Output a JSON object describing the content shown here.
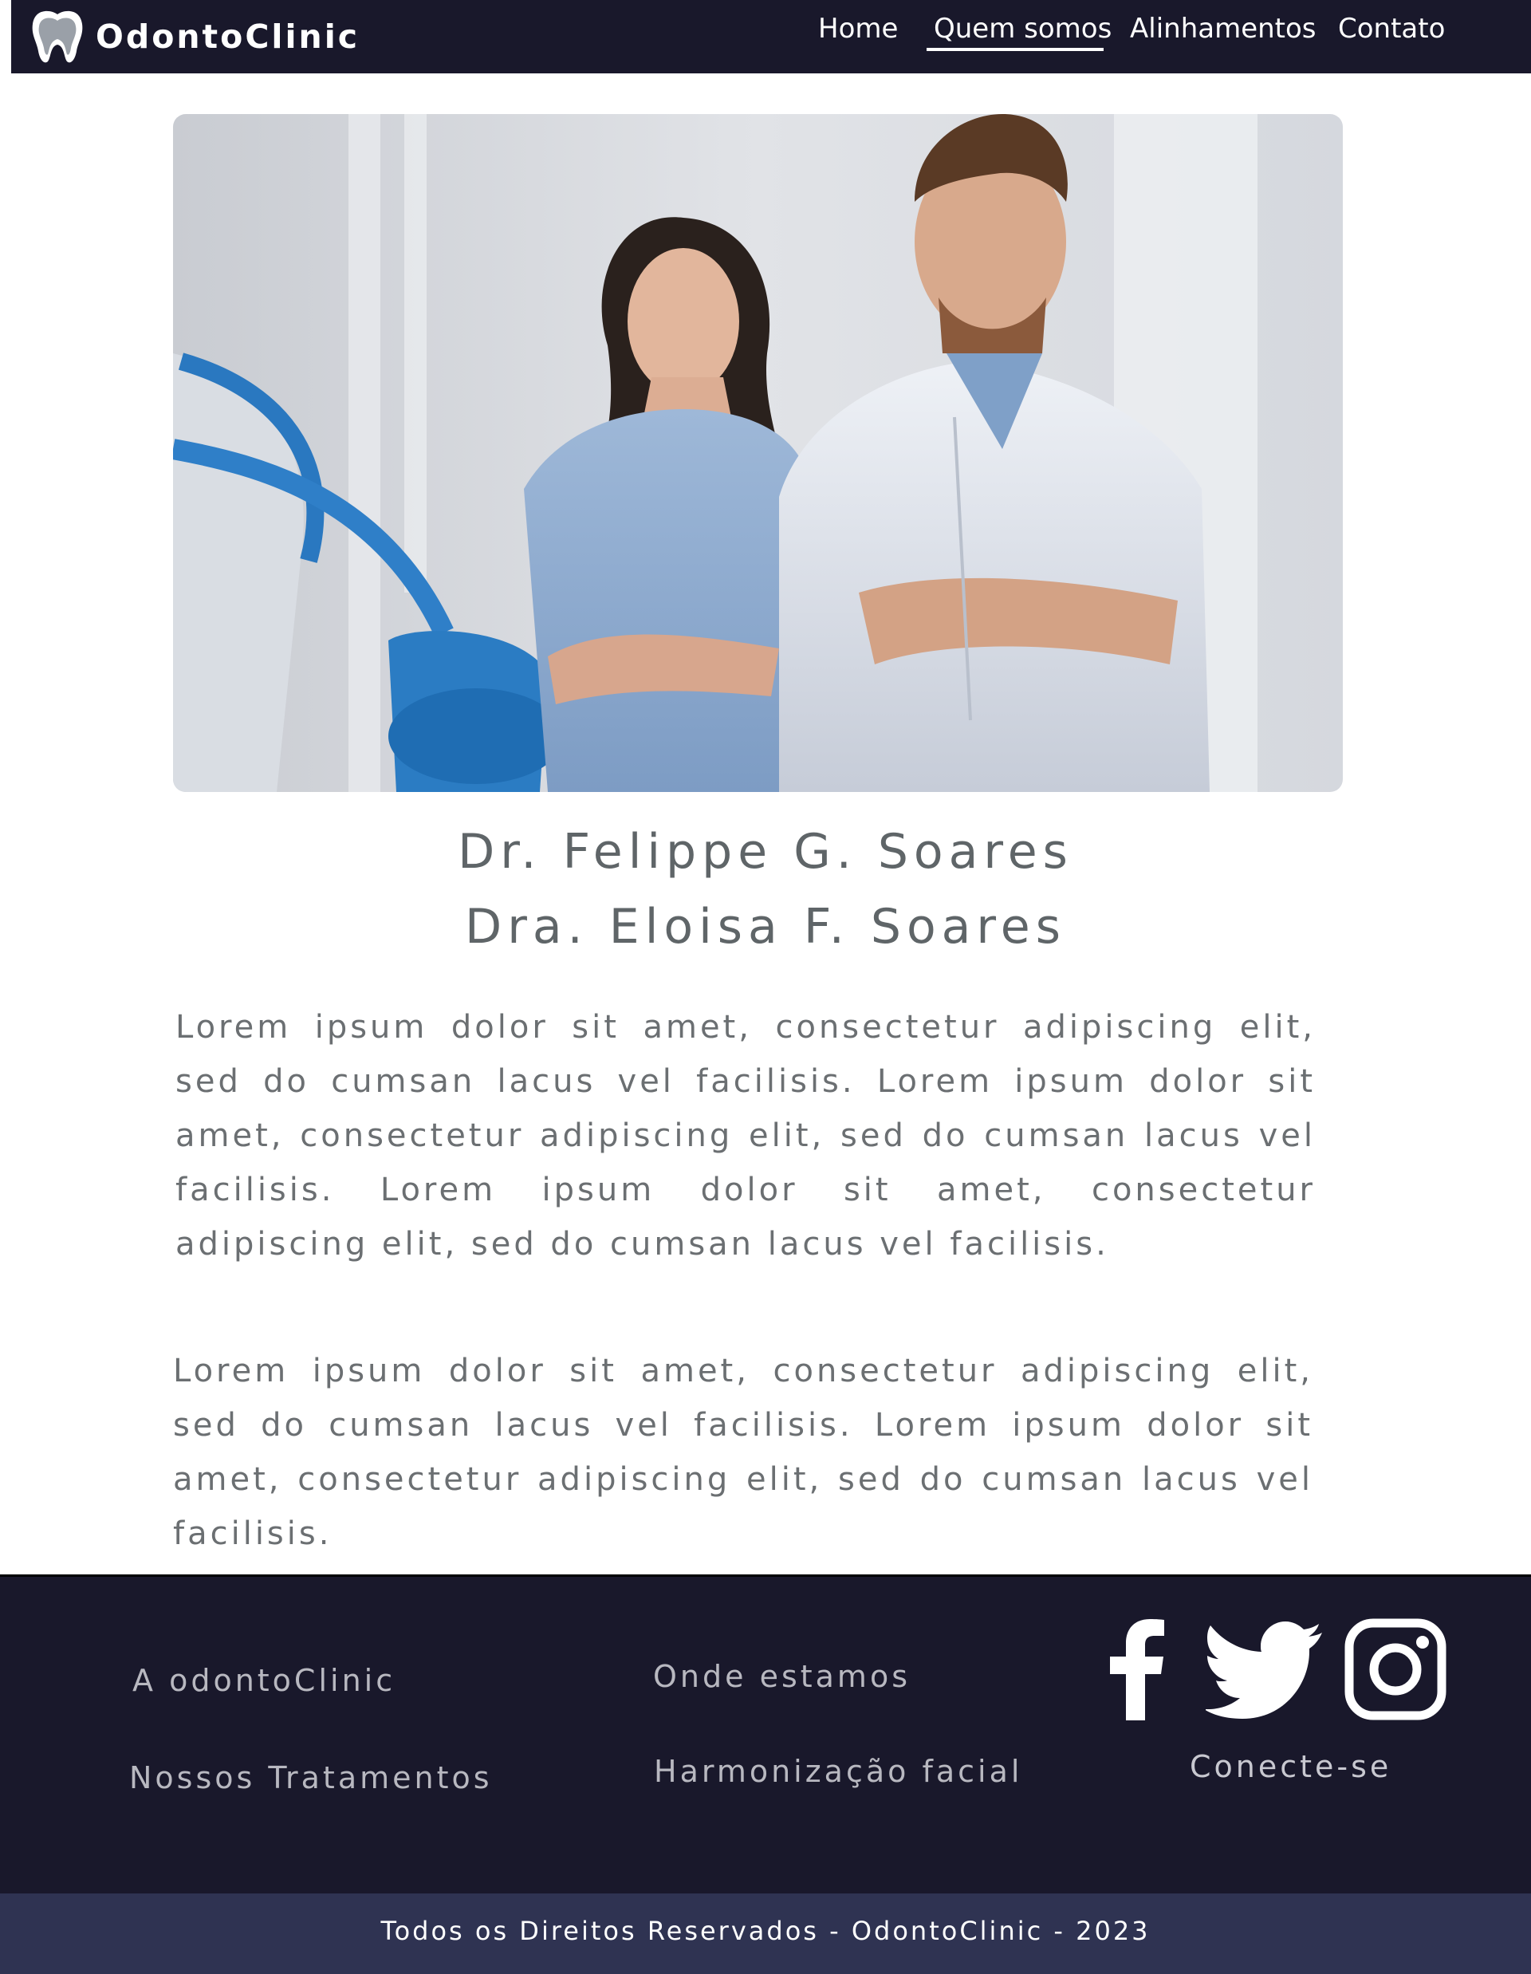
{
  "header": {
    "brand": "OdontoClinic",
    "nav": [
      "Home",
      "Quem somos",
      "Alinhamentos",
      "Contato"
    ],
    "active_nav": "Quem somos"
  },
  "main": {
    "names": [
      "Dr. Felippe G. Soares",
      "Dra. Eloisa F. Soares"
    ],
    "paragraphs": [
      "Lorem ipsum dolor sit amet, consectetur adipiscing elit, sed do cumsan lacus vel facilisis. Lorem ipsum dolor sit amet, consectetur adipiscing elit, sed do cumsan lacus vel facilisis. Lorem ipsum dolor sit amet, consectetur adipiscing elit, sed do cumsan lacus vel facilisis.",
      "Lorem ipsum dolor sit amet, consectetur adipiscing elit, sed do cumsan lacus vel facilisis. Lorem ipsum dolor sit amet, consectetur adipiscing elit, sed do cumsan lacus vel facilisis."
    ]
  },
  "footer": {
    "links": {
      "about": "A odontoClinic",
      "treatments": "Nossos Tratamentos",
      "location": "Onde estamos",
      "facial": "Harmonização facial"
    },
    "social_label": "Conecte-se",
    "social_icons": [
      "facebook-icon",
      "twitter-icon",
      "instagram-icon"
    ],
    "copyright": "Todos os Direitos Reservados - OdontoClinic - 2023"
  },
  "colors": {
    "header_bg": "#19182b",
    "footer_bg": "#19182b",
    "copyright_bg": "#2f3352",
    "text_gray": "#6b6f72"
  }
}
